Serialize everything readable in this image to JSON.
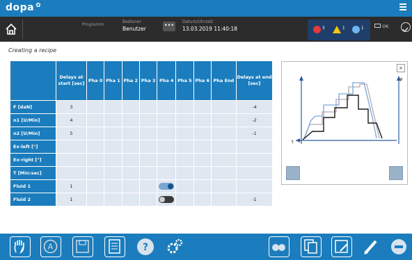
{
  "app": {
    "logo": "dopa",
    "logo_mark": "✿"
  },
  "status": {
    "program_label": "Programm",
    "operator_label": "Bediener",
    "operator_value": "Benutzer",
    "more_button": "•••",
    "datetime_label": "Datum/Uhrzeit",
    "datetime_value": "13.03.2019 11:40:18",
    "alarm_error_count": "3",
    "alarm_warning_count": "1",
    "alarm_info_count": "1",
    "ok_text": "OK"
  },
  "page": {
    "title": "Creating a recipe"
  },
  "table": {
    "headers": [
      "Delays at start [sec]",
      "Pha 0",
      "Pha 1",
      "Pha 2",
      "Pha 3",
      "Pha 4",
      "Pha 5",
      "Pha 6",
      "Pha End",
      "Delays at end [sec]"
    ],
    "rows": [
      {
        "label": "F   [daN]",
        "cells": [
          "3",
          "",
          "",
          "",
          "",
          "",
          "",
          "",
          "",
          "-4"
        ]
      },
      {
        "label": "n1  [U/Min]",
        "cells": [
          "4",
          "",
          "",
          "",
          "",
          "",
          "",
          "",
          "",
          "-2"
        ]
      },
      {
        "label": "n2  [U/Min]",
        "cells": [
          "5",
          "",
          "",
          "",
          "",
          "",
          "",
          "",
          "",
          "-1"
        ]
      },
      {
        "label": "Ex-left [°]",
        "cells": [
          "",
          "",
          "",
          "",
          "",
          "",
          "",
          "",
          "",
          ""
        ]
      },
      {
        "label": "Ex-right  [°]",
        "cells": [
          "",
          "",
          "",
          "",
          "",
          "",
          "",
          "",
          "",
          ""
        ]
      },
      {
        "label": "T   [Min:sec]",
        "cells": [
          "",
          "",
          "",
          "",
          "",
          "",
          "",
          "",
          "",
          ""
        ]
      },
      {
        "label": "Fluid 1",
        "cells": [
          "1",
          "",
          "",
          "",
          "",
          "",
          "",
          "",
          "",
          ""
        ],
        "toggle_on": true
      },
      {
        "label": "Fluid 2",
        "cells": [
          "1",
          "",
          "",
          "",
          "",
          "",
          "",
          "",
          "",
          "-1"
        ],
        "toggle_on": false
      }
    ]
  },
  "graph": {
    "y_label": "F",
    "x_label": "t",
    "close": "×"
  },
  "colors": {
    "brand": "#1b7dbd",
    "status_bg": "#2c2c2c",
    "cell": "#dfe7f1",
    "toggle_on": "#7aa6d6",
    "toggle_off": "#3a3a3a"
  },
  "toolbar": {
    "icons": [
      "hand-icon",
      "automatic-icon",
      "save-disk-icon",
      "manual-book-icon",
      "help-icon",
      "settings-gears-icon",
      "operator-mode-icon",
      "copy-recipe-icon",
      "save-as-icon",
      "edit-pen-icon",
      "stop-icon"
    ]
  }
}
